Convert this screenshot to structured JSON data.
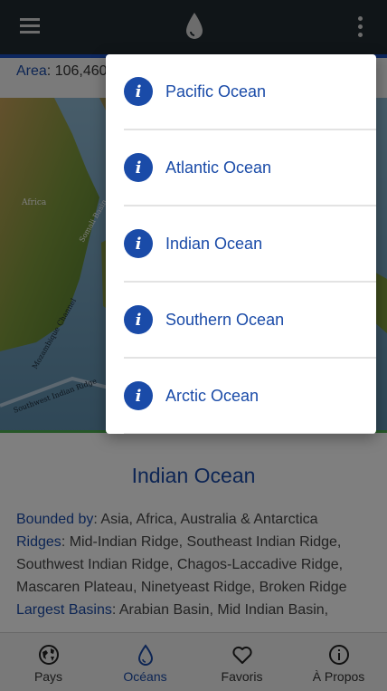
{
  "topbar": {
    "menu_icon": "hamburger-icon",
    "logo_icon": "water-drop-icon",
    "more_icon": "kebab-icon"
  },
  "area": {
    "label": "Area",
    "value": ": 106,460"
  },
  "map": {
    "labels": [
      "Africa",
      "Somali Basin",
      "Mozambique Channel",
      "Southwest Indian Ridge"
    ]
  },
  "content": {
    "title": "Indian Ocean",
    "bounded_label": "Bounded by",
    "bounded_value": ": Asia, Africa, Australia & Antarctica",
    "ridges_label": "Ridges",
    "ridges_value": ": Mid-Indian Ridge, Southeast Indian Ridge, Southwest Indian Ridge, Chagos-Laccadive Ridge, Mascaren Plateau, Ninetyeast Ridge, Broken Ridge",
    "basins_label": "Largest Basins",
    "basins_value": ": Arabian Basin, Mid Indian Basin,"
  },
  "dropdown": {
    "items": [
      {
        "label": "Pacific Ocean",
        "icon": "info-icon"
      },
      {
        "label": "Atlantic Ocean",
        "icon": "info-icon"
      },
      {
        "label": "Indian Ocean",
        "icon": "info-icon"
      },
      {
        "label": "Southern Ocean",
        "icon": "info-icon"
      },
      {
        "label": "Arctic Ocean",
        "icon": "info-icon"
      }
    ],
    "info_glyph": "i"
  },
  "bottomnav": {
    "items": [
      {
        "label": "Pays",
        "icon": "globe-icon"
      },
      {
        "label": "Océans",
        "icon": "water-drop-icon"
      },
      {
        "label": "Favoris",
        "icon": "heart-icon"
      },
      {
        "label": "À Propos",
        "icon": "info-circle-icon"
      }
    ]
  },
  "colors": {
    "accent": "#1a4ba8",
    "topbar": "#212b31",
    "ridge_line": "#4caf50"
  }
}
